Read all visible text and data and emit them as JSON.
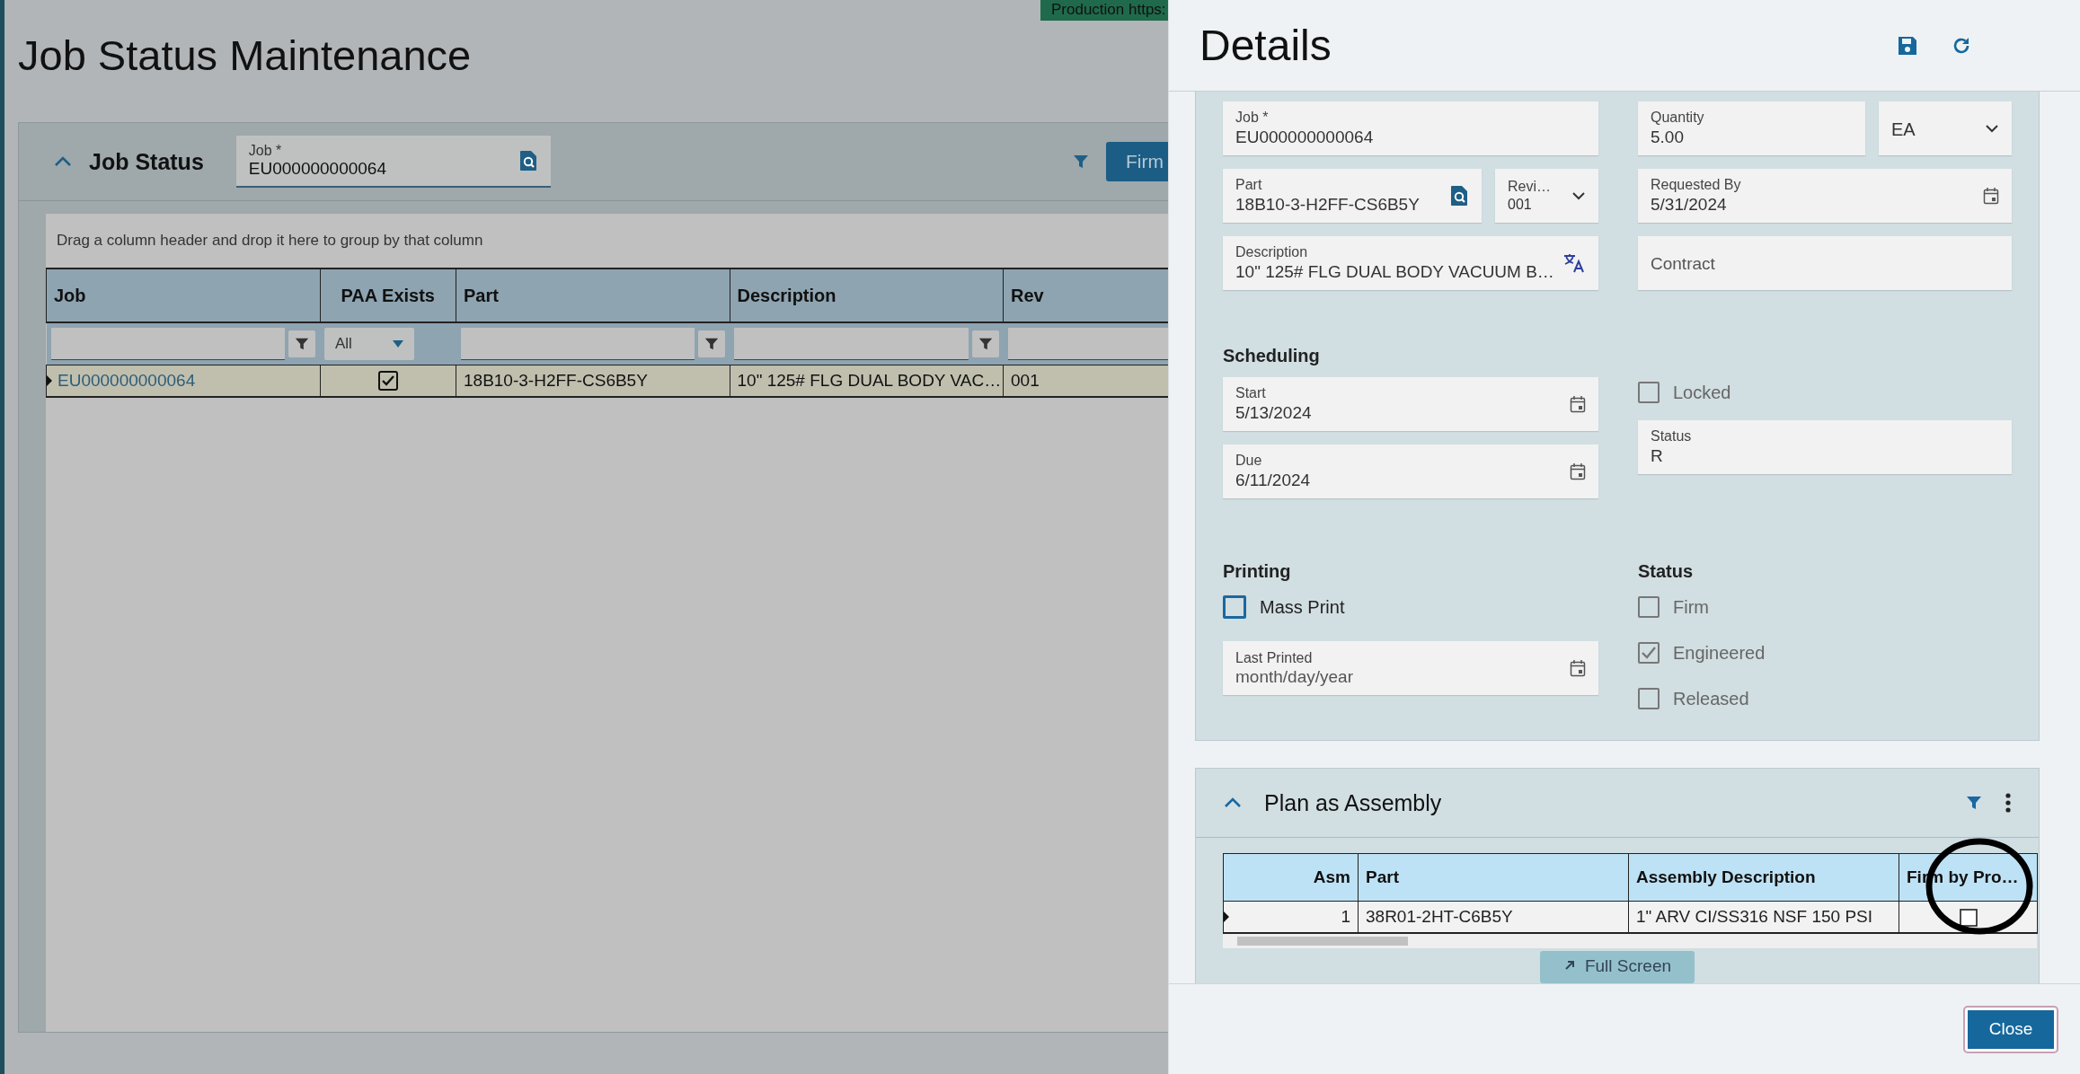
{
  "environment_tag": "Production  https:",
  "page_title": "Job Status Maintenance",
  "job_status": {
    "title": "Job Status",
    "job_field": {
      "label": "Job *",
      "value": "EU000000000064"
    },
    "action_button": "Firm",
    "group_hint": "Drag a column header and drop it here to group by that column",
    "columns": [
      "Job",
      "PAA Exists",
      "Part",
      "Description",
      "Rev"
    ],
    "filters": [
      {
        "kind": "text"
      },
      {
        "kind": "select",
        "value": "All"
      },
      {
        "kind": "text"
      },
      {
        "kind": "text"
      },
      {
        "kind": "plain"
      }
    ],
    "rows": [
      {
        "job": "EU000000000064",
        "paa_exists": true,
        "part": "18B10-3-H2FF-CS6B5Y",
        "description": "10\" 125# FLG DUAL BODY VAC…",
        "rev": "001",
        "selected": true
      }
    ]
  },
  "details": {
    "title": "Details",
    "job": {
      "label": "Job *",
      "value": "EU000000000064"
    },
    "quantity": {
      "label": "Quantity",
      "value": "5.00"
    },
    "uom": {
      "value": "EA"
    },
    "part": {
      "label": "Part",
      "value": "18B10-3-H2FF-CS6B5Y"
    },
    "revision": {
      "label": "Revi…",
      "value": "001"
    },
    "requested_by": {
      "label": "Requested By",
      "value": "5/31/2024"
    },
    "description": {
      "label": "Description",
      "value": "10\" 125# FLG DUAL BODY VACUUM B…"
    },
    "contract": {
      "placeholder": "Contract"
    },
    "scheduling": {
      "title": "Scheduling",
      "start": {
        "label": "Start",
        "value": "5/13/2024"
      },
      "due": {
        "label": "Due",
        "value": "6/11/2024"
      },
      "locked": {
        "label": "Locked",
        "checked": false,
        "disabled": true
      },
      "status": {
        "label": "Status",
        "value": "R"
      }
    },
    "printing": {
      "title": "Printing",
      "mass_print": {
        "label": "Mass Print",
        "checked": false,
        "disabled": false
      },
      "last_printed": {
        "label": "Last Printed",
        "placeholder": "month/day/year"
      }
    },
    "status": {
      "title": "Status",
      "options": [
        {
          "label": "Firm",
          "checked": false,
          "disabled": true
        },
        {
          "label": "Engineered",
          "checked": true,
          "disabled": true
        },
        {
          "label": "Released",
          "checked": false,
          "disabled": true
        }
      ]
    }
  },
  "plan_as_assembly": {
    "title": "Plan as Assembly",
    "columns": [
      "Asm",
      "Part",
      "Assembly Description",
      "Firm by Pro…"
    ],
    "rows": [
      {
        "asm": "1",
        "part": "38R01-2HT-C6B5Y",
        "description": "1\" ARV CI/SS316 NSF 150 PSI",
        "firm_by_process": false,
        "selected": true
      }
    ],
    "full_screen_button": "Full Screen"
  },
  "close_button": "Close"
}
